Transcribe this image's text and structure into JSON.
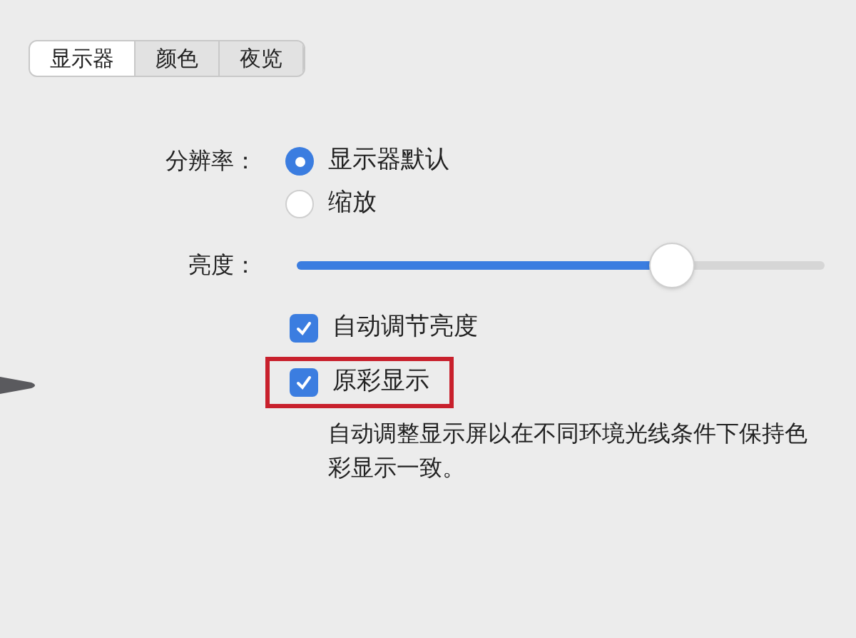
{
  "tabs": [
    {
      "label": "显示器",
      "selected": true
    },
    {
      "label": "颜色",
      "selected": false
    },
    {
      "label": "夜览",
      "selected": false
    }
  ],
  "resolution": {
    "label": "分辨率：",
    "options": [
      {
        "label": "显示器默认",
        "selected": true
      },
      {
        "label": "缩放",
        "selected": false
      }
    ]
  },
  "brightness": {
    "label": "亮度：",
    "level": 0.71
  },
  "options": [
    {
      "label": "自动调节亮度",
      "checked": true,
      "highlighted": false
    },
    {
      "label": "原彩显示",
      "checked": true,
      "highlighted": true
    }
  ],
  "description": "自动调整显示屏以在不同环境光线条件下保持色彩显示一致。"
}
